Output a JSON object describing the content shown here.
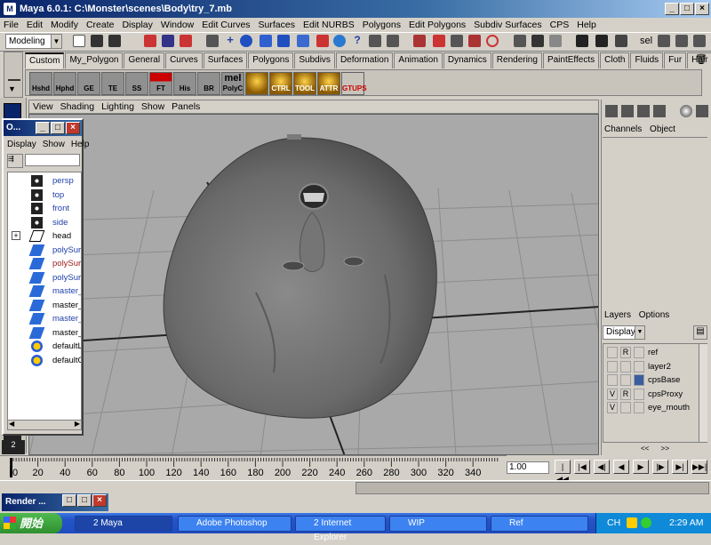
{
  "window": {
    "title": "Maya 6.0.1: C:\\Monster\\scenes\\Body\\try_7.mb",
    "app_icon": "M"
  },
  "menubar": [
    "File",
    "Edit",
    "Modify",
    "Create",
    "Display",
    "Window",
    "Edit Curves",
    "Surfaces",
    "Edit NURBS",
    "Polygons",
    "Edit Polygons",
    "Subdiv Surfaces",
    "CPS",
    "Help"
  ],
  "statusline": {
    "mode": "Modeling",
    "sel_label": "sel"
  },
  "shelf_tabs": [
    "Custom",
    "My_Polygon",
    "General",
    "Curves",
    "Surfaces",
    "Polygons",
    "Subdivs",
    "Deformation",
    "Animation",
    "Dynamics",
    "Rendering",
    "PaintEffects",
    "Cloth",
    "Fluids",
    "Fur",
    "Hair"
  ],
  "shelf_buttons": [
    "Hshd",
    "Hphd",
    "GE",
    "TE",
    "SS",
    "FT",
    "His",
    "BR",
    "PolyC",
    "",
    "CTRL",
    "TOOL",
    "ATTR",
    "GTUPS"
  ],
  "shelf_top_labels": {
    "mel": "mel"
  },
  "viewport_menu": [
    "View",
    "Shading",
    "Lighting",
    "Show",
    "Panels"
  ],
  "outliner": {
    "title": "O...",
    "menu": [
      "Display",
      "Show",
      "Help"
    ],
    "items": [
      {
        "label": "persp",
        "icon": "camera-icon",
        "color": "#1f3fa8"
      },
      {
        "label": "top",
        "icon": "camera-icon",
        "color": "#1f3fa8"
      },
      {
        "label": "front",
        "icon": "camera-icon",
        "color": "#1f3fa8"
      },
      {
        "label": "side",
        "icon": "camera-icon",
        "color": "#1f3fa8"
      },
      {
        "label": "head",
        "icon": "curve-icon",
        "color": "#000000",
        "expander": "+"
      },
      {
        "label": "polySurf",
        "icon": "mesh-icon",
        "color": "#1f3fa8"
      },
      {
        "label": "polySurf",
        "icon": "mesh-icon",
        "color": "#a02020"
      },
      {
        "label": "polySurf",
        "icon": "mesh-icon",
        "color": "#1f3fa8"
      },
      {
        "label": "master_",
        "icon": "mesh-icon",
        "color": "#1f3fa8"
      },
      {
        "label": "master_",
        "icon": "mesh-icon",
        "color": "#000000"
      },
      {
        "label": "master_",
        "icon": "mesh-icon",
        "color": "#1f3fa8"
      },
      {
        "label": "master_",
        "icon": "mesh-icon",
        "color": "#000000"
      },
      {
        "label": "defaultL",
        "icon": "light-set-icon",
        "color": "#000000"
      },
      {
        "label": "defaultO",
        "icon": "object-set-icon",
        "color": "#000000"
      }
    ]
  },
  "channelbox": {
    "tabs": [
      "Channels",
      "Object"
    ]
  },
  "layers": {
    "menu": [
      "Layers",
      "Options"
    ],
    "display": "Display",
    "rows": [
      {
        "v": "",
        "r": "R",
        "name": "ref",
        "color": ""
      },
      {
        "v": "",
        "r": "",
        "name": "layer2",
        "color": ""
      },
      {
        "v": "",
        "r": "",
        "name": "cpsBase",
        "color": "#3a5fa0"
      },
      {
        "v": "V",
        "r": "R",
        "name": "cpsProxy",
        "color": ""
      },
      {
        "v": "V",
        "r": "",
        "name": "eye_mouth",
        "color": ""
      }
    ]
  },
  "timeline": {
    "ticks": [
      "0",
      "20",
      "40",
      "60",
      "80",
      "100",
      "120",
      "140",
      "160",
      "180",
      "200",
      "220",
      "240",
      "260",
      "280",
      "300",
      "320",
      "340"
    ],
    "current": "1.00",
    "side_marks": "2"
  },
  "render_window": {
    "title": "Render ..."
  },
  "taskbar": {
    "start": "開始",
    "tasks": [
      {
        "label": "2 Maya",
        "active": true
      },
      {
        "label": "Adobe Photoshop",
        "active": false
      },
      {
        "label": "2 Internet Explorer",
        "active": false
      },
      {
        "label": "WIP",
        "active": false
      },
      {
        "label": "Ref",
        "active": false
      }
    ],
    "lang": "CH",
    "clock": "2:29 AM"
  }
}
